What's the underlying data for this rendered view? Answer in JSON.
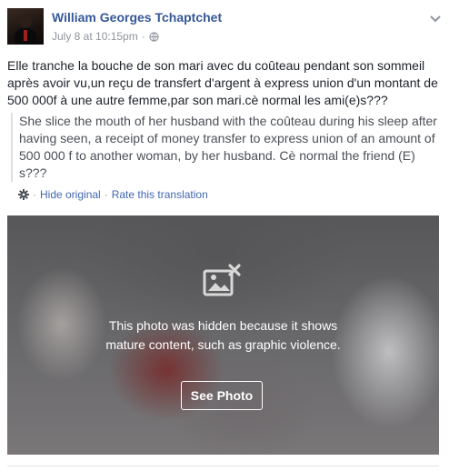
{
  "post": {
    "author": "William Georges Tchaptchet",
    "timestamp": "July 8 at 10:15pm",
    "meta_separator": "·",
    "privacy_icon": "globe-icon",
    "menu_icon": "chevron-down-icon",
    "text": "Elle tranche la bouche de son mari avec du coûteau pendant son sommeil après avoir vu,un reçu de transfert d'argent à express union d'un montant de 500 000f à une autre femme,par son mari.cè normal les ami(e)s???",
    "translation": "She slice the mouth of her husband with the coûteau during his sleep after having seen, a receipt of money transfer to express union of an amount of 500 000 f to another woman, by her husband. Cè normal the friend (E) s???"
  },
  "translation_links": {
    "settings_icon": "gear-icon",
    "hide_original": "Hide original",
    "separator": "·",
    "rate_translation": "Rate this translation"
  },
  "photo_cover": {
    "icon": "hidden-photo-icon",
    "message": "This photo was hidden because it shows mature content, such as graphic violence.",
    "button_label": "See Photo"
  },
  "colors": {
    "author_link": "#365899",
    "link": "#4267b2",
    "meta_text": "#90949c",
    "body_text": "#1d2129"
  }
}
